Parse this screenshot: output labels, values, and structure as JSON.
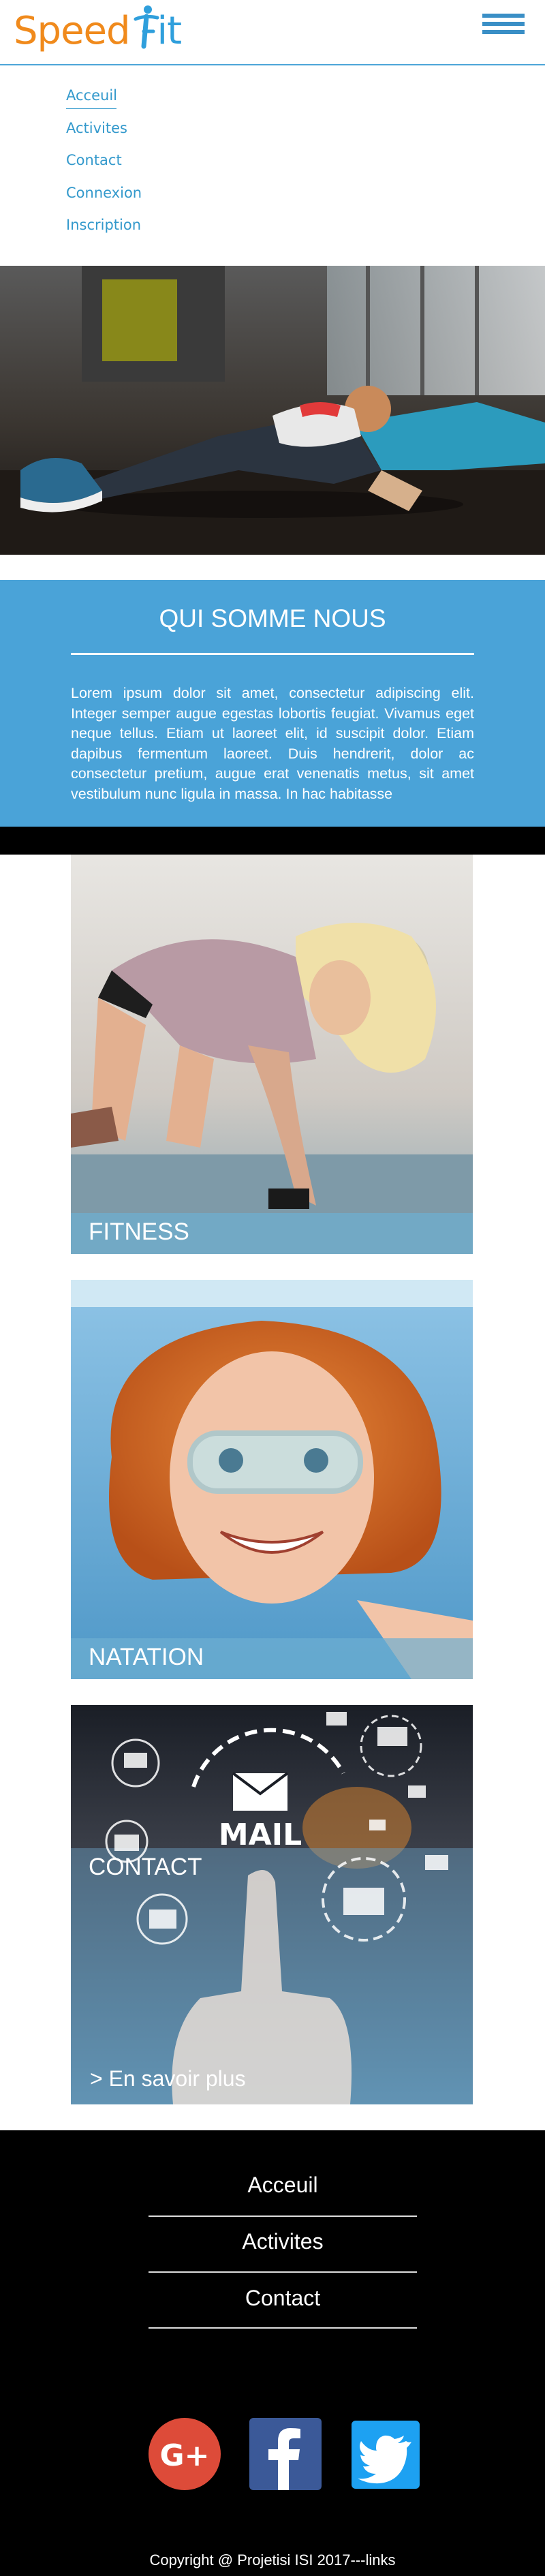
{
  "brand": {
    "part1": "Speed",
    "part2": "it"
  },
  "nav": {
    "items": [
      "Acceuil",
      "Activites",
      "Contact",
      "Connexion",
      "Inscription"
    ]
  },
  "about": {
    "title": "QUI SOMME NOUS",
    "text": "Lorem ipsum dolor sit amet, consectetur adipiscing elit. Integer semper augue egestas lobortis feugiat. Vivamus eget neque tellus. Etiam ut laoreet elit, id suscipit dolor. Etiam dapibus fermentum laoreet. Duis hendrerit, dolor ac consectetur pretium, augue erat venenatis metus, sit amet vestibulum nunc ligula in massa. In hac habitasse"
  },
  "cards": {
    "fitness": "FITNESS",
    "natation": "NATATION",
    "contact": "CONTACT",
    "more": "> En savoir plus",
    "mail_text": "MAIL"
  },
  "footer": {
    "links": [
      "Acceuil",
      "Activites",
      "Contact"
    ],
    "social": {
      "google": "G+"
    },
    "copyright": "Copyright @ Projetisi ISI 2017---links"
  },
  "colors": {
    "brand_orange": "#f08a1c",
    "brand_blue": "#2f9fdc",
    "section_blue": "#4aa3d8",
    "google_red": "#dd4b39",
    "facebook_blue": "#3b5998",
    "twitter_blue": "#1da1f2"
  },
  "icons": [
    "runner-logo-icon",
    "hamburger-menu-icon",
    "google-plus-icon",
    "facebook-icon",
    "twitter-icon",
    "mail-icon"
  ]
}
